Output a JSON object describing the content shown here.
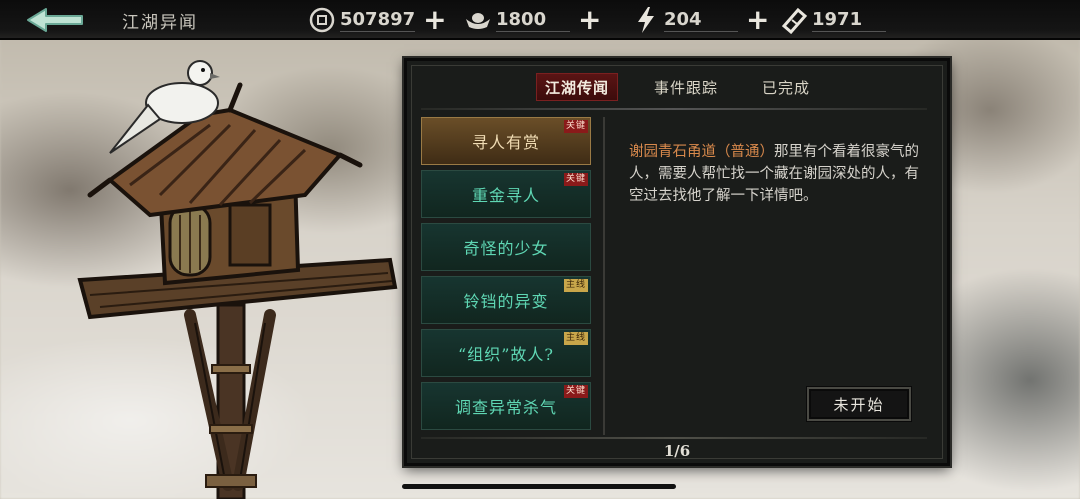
{
  "header": {
    "title": "江湖异闻",
    "resources": [
      {
        "name": "coin",
        "icon": "coin-icon",
        "value": "507897"
      },
      {
        "name": "silver",
        "icon": "silver-ingot-icon",
        "value": "1800"
      },
      {
        "name": "energy",
        "icon": "lightning-icon",
        "value": "204"
      },
      {
        "name": "ticket",
        "icon": "ticket-icon",
        "value": "1971"
      }
    ],
    "plus": "+"
  },
  "panel": {
    "tabs": [
      {
        "label": "江湖传闻",
        "active": true
      },
      {
        "label": "事件跟踪",
        "active": false
      },
      {
        "label": "已完成",
        "active": false
      }
    ],
    "events": [
      {
        "label": "寻人有赏",
        "tag": "关键",
        "tag_type": "key",
        "selected": true
      },
      {
        "label": "重金寻人",
        "tag": "关键",
        "tag_type": "key",
        "selected": false
      },
      {
        "label": "奇怪的少女",
        "tag": "",
        "tag_type": "",
        "selected": false
      },
      {
        "label": "铃铛的异变",
        "tag": "主线",
        "tag_type": "main",
        "selected": false
      },
      {
        "label": "“组织”故人?",
        "tag": "主线",
        "tag_type": "main",
        "selected": false
      },
      {
        "label": "调查异常杀气",
        "tag": "关键",
        "tag_type": "key",
        "selected": false
      }
    ],
    "description": {
      "location": "谢园青石甬道（普通）",
      "text": "那里有个看着很豪气的人，需要人帮忙找一个藏在谢园深处的人，有空过去找他了解一下详情吧。"
    },
    "status_button": "未开始",
    "page": "1/6"
  },
  "colors": {
    "accent_green": "#5fd7b4",
    "selected_gold": "#6a4e28",
    "tab_red": "#5a1414",
    "location_orange": "#d8894c"
  }
}
